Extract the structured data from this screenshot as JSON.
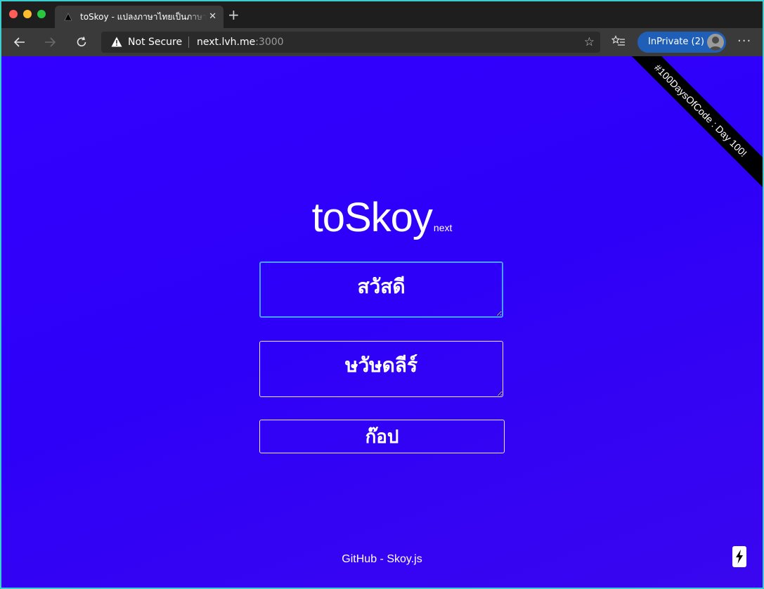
{
  "browser": {
    "tab_title": "toSkoy - แปลงภาษาไทยเป็นภาษาสกอย",
    "tab_close": "✕",
    "new_tab": "+",
    "security_label": "Not Secure",
    "url_host": "next.lvh.me",
    "url_port": ":3000",
    "inprivate_label": "InPrivate (2)",
    "more_label": "···"
  },
  "page": {
    "ribbon_text": "#100DaysOfCode : Day 100!",
    "logo_main": "toSkoy",
    "logo_sub": "next",
    "input_value": "สวัสดี",
    "output_value": "ษวัษดลีร์",
    "copy_label": "ก๊อป",
    "footer_link": "GitHub - Skoy.js"
  },
  "colors": {
    "page_background": "#3300ff",
    "focus_border": "#4aa0ff",
    "inprivate_pill": "#1f5fb8"
  },
  "icons": [
    "back-arrow-icon",
    "forward-arrow-icon",
    "refresh-icon",
    "warning-icon",
    "star-icon",
    "favorites-icon",
    "avatar",
    "more-icon",
    "lightning-icon"
  ]
}
